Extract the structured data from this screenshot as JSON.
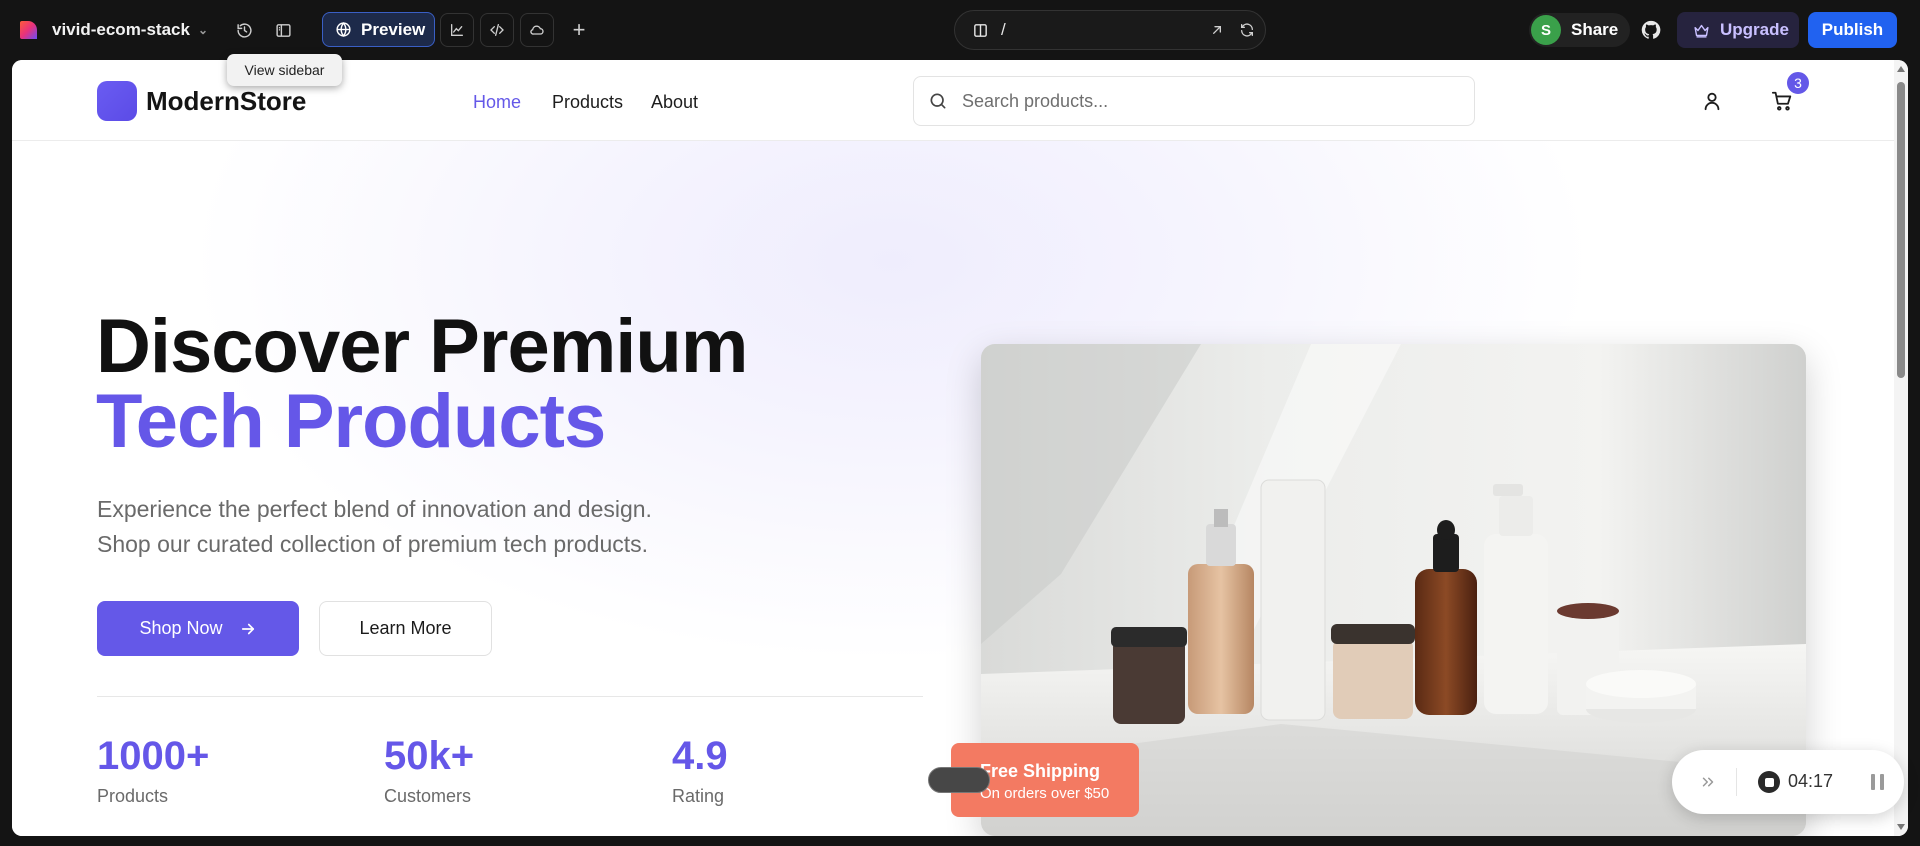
{
  "editor": {
    "project_name": "vivid-ecom-stack",
    "preview_label": "Preview",
    "url_path": "/",
    "share_label": "Share",
    "avatar_initial": "S",
    "upgrade_label": "Upgrade",
    "publish_label": "Publish",
    "tooltip": "View sidebar"
  },
  "store": {
    "brand": "ModernStore",
    "nav": [
      {
        "label": "Home",
        "active": true
      },
      {
        "label": "Products",
        "active": false
      },
      {
        "label": "About",
        "active": false
      }
    ],
    "search_placeholder": "Search products...",
    "cart_count": "3"
  },
  "hero": {
    "title_line1": "Discover Premium",
    "title_line2": "Tech Products",
    "subtitle_line1": "Experience the perfect blend of innovation and design.",
    "subtitle_line2": "Shop our curated collection of premium tech products.",
    "primary_cta": "Shop Now",
    "secondary_cta": "Learn More",
    "stats": [
      {
        "value": "1000+",
        "label": "Products"
      },
      {
        "value": "50k+",
        "label": "Customers"
      },
      {
        "value": "4.9",
        "label": "Rating"
      }
    ],
    "shipping_title": "Free Shipping",
    "shipping_sub": "On orders over $50"
  },
  "recorder": {
    "time": "04:17"
  },
  "colors": {
    "accent": "#6458e8",
    "publish": "#2162f0",
    "shipping_badge": "#f37a62",
    "editor_bg": "#141414"
  },
  "icons": [
    "logo-icon",
    "history-icon",
    "sidebar-icon",
    "globe-icon",
    "chart-icon",
    "code-icon",
    "cloud-icon",
    "plus-icon",
    "page-icon",
    "external-link-icon",
    "refresh-icon",
    "github-icon",
    "crown-icon",
    "search-icon",
    "user-icon",
    "cart-icon",
    "arrow-right-icon",
    "skip-icon",
    "stop-icon",
    "pause-icon"
  ]
}
